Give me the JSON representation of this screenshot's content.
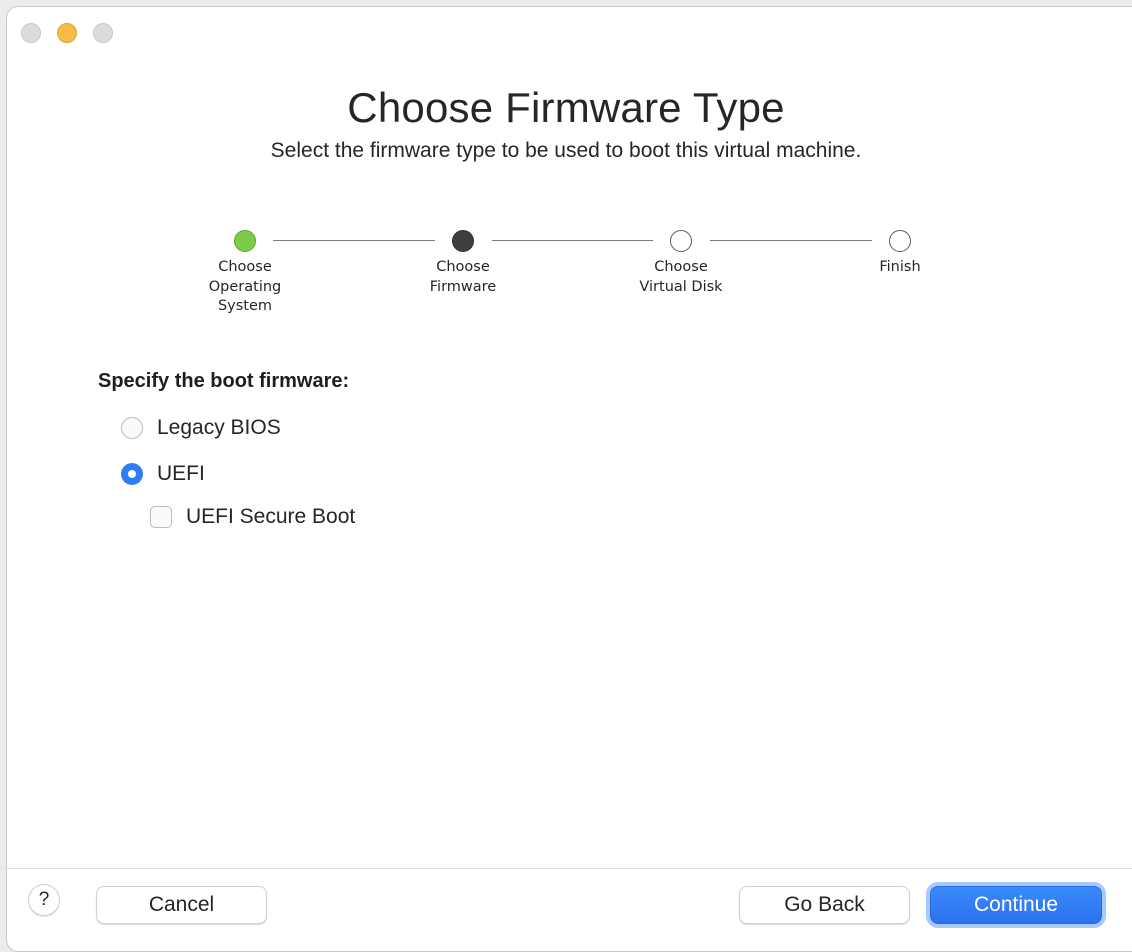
{
  "window": {
    "controls": [
      "close-button",
      "minimize-button",
      "zoom-button"
    ]
  },
  "header": {
    "title": "Choose Firmware Type",
    "subtitle": "Select the firmware type to be used to boot this virtual machine."
  },
  "stepper": {
    "steps": [
      {
        "label_lines": [
          "Choose",
          "Operating",
          "System"
        ],
        "state": "done"
      },
      {
        "label_lines": [
          "Choose",
          "Firmware"
        ],
        "state": "current"
      },
      {
        "label_lines": [
          "Choose",
          "Virtual Disk"
        ],
        "state": "todo"
      },
      {
        "label_lines": [
          "Finish"
        ],
        "state": "todo"
      }
    ]
  },
  "form": {
    "section_label": "Specify the boot firmware:",
    "options": [
      {
        "label": "Legacy BIOS",
        "selected": false
      },
      {
        "label": "UEFI",
        "selected": true
      }
    ],
    "secure_boot": {
      "label": "UEFI Secure Boot",
      "checked": false
    }
  },
  "footer": {
    "help_label": "?",
    "cancel_label": "Cancel",
    "back_label": "Go Back",
    "continue_label": "Continue"
  },
  "colors": {
    "accent": "#2f7bf6",
    "step_done": "#7ecb4a",
    "step_current": "#3f3f3f",
    "minimize": "#f6bd44"
  }
}
